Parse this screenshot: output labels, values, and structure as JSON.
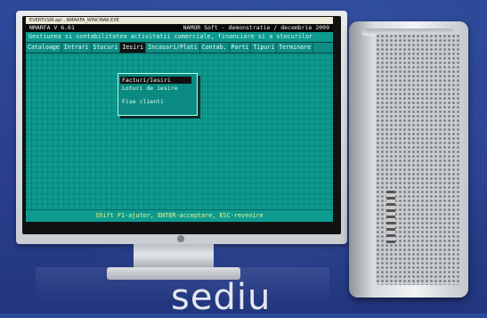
{
  "window": {
    "title": "EVERTUSIR.epi ..NMARFA_WINCMAR.EXE"
  },
  "app": {
    "name_version": "NMARFA V 6.61",
    "vendor_note": "NAMOR Soft - demonstratie / decembrie 2009",
    "subtitle": "Gestiunea si contabilitatea activitatii comerciale, financiare si a stocurilor"
  },
  "menu": {
    "items": [
      {
        "label": "Cataloage"
      },
      {
        "label": "Intrari"
      },
      {
        "label": "Stocuri"
      },
      {
        "label": "Iesiri"
      },
      {
        "label": "Incasari/Plati"
      },
      {
        "label": "Contab."
      },
      {
        "label": "Parti"
      },
      {
        "label": "Tipuri"
      },
      {
        "label": "Terminare"
      }
    ],
    "active_index": 3
  },
  "dropdown": {
    "items": [
      {
        "label": "Facturi/Iesiri"
      },
      {
        "label": "Loturi de iesire"
      },
      {
        "label": "Fise clienti"
      }
    ],
    "selected_index": 0
  },
  "footer": {
    "hint": "Shift F1-ajutor, ENTER-acceptare, ESC-revenire"
  },
  "caption": {
    "text": "sediu"
  }
}
